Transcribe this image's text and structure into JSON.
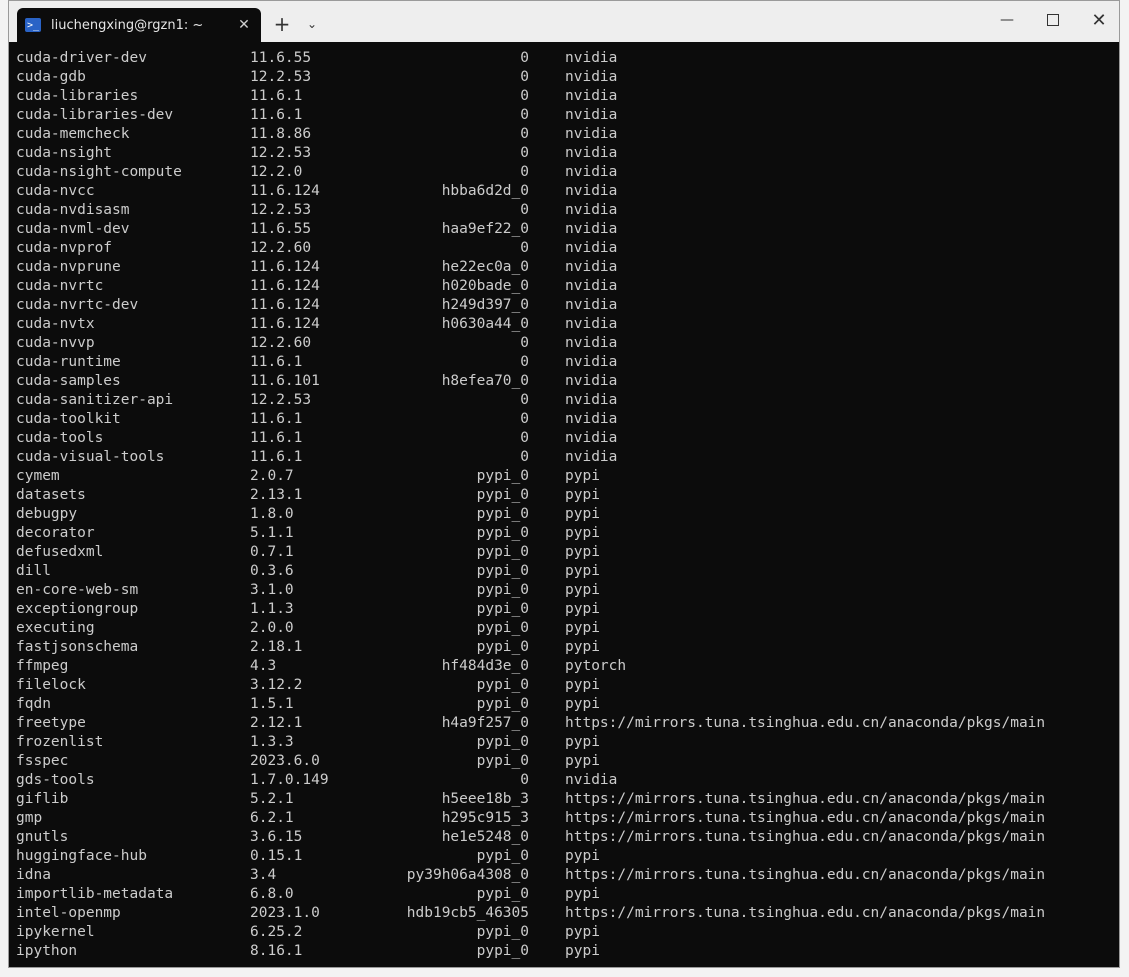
{
  "window": {
    "tab_title": "liuchengxing@rgzn1: ~",
    "tab_icon": "terminal-icon",
    "new_tab_label": "+",
    "dropdown_label": "⌄",
    "minimize_label": "—",
    "close_label": "✕",
    "tab_close_label": "✕"
  },
  "terminal": {
    "rows": [
      {
        "name": "cuda-driver-dev",
        "version": "11.6.55",
        "build": "0",
        "channel": "nvidia"
      },
      {
        "name": "cuda-gdb",
        "version": "12.2.53",
        "build": "0",
        "channel": "nvidia"
      },
      {
        "name": "cuda-libraries",
        "version": "11.6.1",
        "build": "0",
        "channel": "nvidia"
      },
      {
        "name": "cuda-libraries-dev",
        "version": "11.6.1",
        "build": "0",
        "channel": "nvidia"
      },
      {
        "name": "cuda-memcheck",
        "version": "11.8.86",
        "build": "0",
        "channel": "nvidia"
      },
      {
        "name": "cuda-nsight",
        "version": "12.2.53",
        "build": "0",
        "channel": "nvidia"
      },
      {
        "name": "cuda-nsight-compute",
        "version": "12.2.0",
        "build": "0",
        "channel": "nvidia"
      },
      {
        "name": "cuda-nvcc",
        "version": "11.6.124",
        "build": "hbba6d2d_0",
        "channel": "nvidia"
      },
      {
        "name": "cuda-nvdisasm",
        "version": "12.2.53",
        "build": "0",
        "channel": "nvidia"
      },
      {
        "name": "cuda-nvml-dev",
        "version": "11.6.55",
        "build": "haa9ef22_0",
        "channel": "nvidia"
      },
      {
        "name": "cuda-nvprof",
        "version": "12.2.60",
        "build": "0",
        "channel": "nvidia"
      },
      {
        "name": "cuda-nvprune",
        "version": "11.6.124",
        "build": "he22ec0a_0",
        "channel": "nvidia"
      },
      {
        "name": "cuda-nvrtc",
        "version": "11.6.124",
        "build": "h020bade_0",
        "channel": "nvidia"
      },
      {
        "name": "cuda-nvrtc-dev",
        "version": "11.6.124",
        "build": "h249d397_0",
        "channel": "nvidia"
      },
      {
        "name": "cuda-nvtx",
        "version": "11.6.124",
        "build": "h0630a44_0",
        "channel": "nvidia"
      },
      {
        "name": "cuda-nvvp",
        "version": "12.2.60",
        "build": "0",
        "channel": "nvidia"
      },
      {
        "name": "cuda-runtime",
        "version": "11.6.1",
        "build": "0",
        "channel": "nvidia"
      },
      {
        "name": "cuda-samples",
        "version": "11.6.101",
        "build": "h8efea70_0",
        "channel": "nvidia"
      },
      {
        "name": "cuda-sanitizer-api",
        "version": "12.2.53",
        "build": "0",
        "channel": "nvidia"
      },
      {
        "name": "cuda-toolkit",
        "version": "11.6.1",
        "build": "0",
        "channel": "nvidia"
      },
      {
        "name": "cuda-tools",
        "version": "11.6.1",
        "build": "0",
        "channel": "nvidia"
      },
      {
        "name": "cuda-visual-tools",
        "version": "11.6.1",
        "build": "0",
        "channel": "nvidia"
      },
      {
        "name": "cymem",
        "version": "2.0.7",
        "build": "pypi_0",
        "channel": "pypi"
      },
      {
        "name": "datasets",
        "version": "2.13.1",
        "build": "pypi_0",
        "channel": "pypi"
      },
      {
        "name": "debugpy",
        "version": "1.8.0",
        "build": "pypi_0",
        "channel": "pypi"
      },
      {
        "name": "decorator",
        "version": "5.1.1",
        "build": "pypi_0",
        "channel": "pypi"
      },
      {
        "name": "defusedxml",
        "version": "0.7.1",
        "build": "pypi_0",
        "channel": "pypi"
      },
      {
        "name": "dill",
        "version": "0.3.6",
        "build": "pypi_0",
        "channel": "pypi"
      },
      {
        "name": "en-core-web-sm",
        "version": "3.1.0",
        "build": "pypi_0",
        "channel": "pypi"
      },
      {
        "name": "exceptiongroup",
        "version": "1.1.3",
        "build": "pypi_0",
        "channel": "pypi"
      },
      {
        "name": "executing",
        "version": "2.0.0",
        "build": "pypi_0",
        "channel": "pypi"
      },
      {
        "name": "fastjsonschema",
        "version": "2.18.1",
        "build": "pypi_0",
        "channel": "pypi"
      },
      {
        "name": "ffmpeg",
        "version": "4.3",
        "build": "hf484d3e_0",
        "channel": "pytorch"
      },
      {
        "name": "filelock",
        "version": "3.12.2",
        "build": "pypi_0",
        "channel": "pypi"
      },
      {
        "name": "fqdn",
        "version": "1.5.1",
        "build": "pypi_0",
        "channel": "pypi"
      },
      {
        "name": "freetype",
        "version": "2.12.1",
        "build": "h4a9f257_0",
        "channel": "https://mirrors.tuna.tsinghua.edu.cn/anaconda/pkgs/main"
      },
      {
        "name": "frozenlist",
        "version": "1.3.3",
        "build": "pypi_0",
        "channel": "pypi"
      },
      {
        "name": "fsspec",
        "version": "2023.6.0",
        "build": "pypi_0",
        "channel": "pypi"
      },
      {
        "name": "gds-tools",
        "version": "1.7.0.149",
        "build": "0",
        "channel": "nvidia"
      },
      {
        "name": "giflib",
        "version": "5.2.1",
        "build": "h5eee18b_3",
        "channel": "https://mirrors.tuna.tsinghua.edu.cn/anaconda/pkgs/main"
      },
      {
        "name": "gmp",
        "version": "6.2.1",
        "build": "h295c915_3",
        "channel": "https://mirrors.tuna.tsinghua.edu.cn/anaconda/pkgs/main"
      },
      {
        "name": "gnutls",
        "version": "3.6.15",
        "build": "he1e5248_0",
        "channel": "https://mirrors.tuna.tsinghua.edu.cn/anaconda/pkgs/main"
      },
      {
        "name": "huggingface-hub",
        "version": "0.15.1",
        "build": "pypi_0",
        "channel": "pypi"
      },
      {
        "name": "idna",
        "version": "3.4",
        "build": "py39h06a4308_0",
        "channel": "https://mirrors.tuna.tsinghua.edu.cn/anaconda/pkgs/main"
      },
      {
        "name": "importlib-metadata",
        "version": "6.8.0",
        "build": "pypi_0",
        "channel": "pypi"
      },
      {
        "name": "intel-openmp",
        "version": "2023.1.0",
        "build": "hdb19cb5_46305",
        "channel": "https://mirrors.tuna.tsinghua.edu.cn/anaconda/pkgs/main"
      },
      {
        "name": "ipykernel",
        "version": "6.25.2",
        "build": "pypi_0",
        "channel": "pypi"
      },
      {
        "name": "ipython",
        "version": "8.16.1",
        "build": "pypi_0",
        "channel": "pypi"
      }
    ]
  }
}
